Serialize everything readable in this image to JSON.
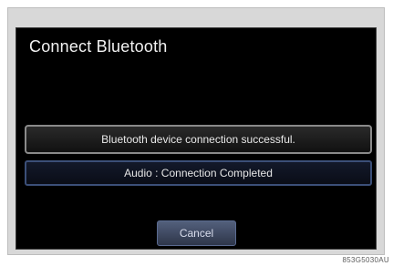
{
  "dialog": {
    "title": "Connect Bluetooth",
    "message": "Bluetooth device connection successful.",
    "status": "Audio : Connection Completed",
    "cancel_label": "Cancel"
  },
  "footer": {
    "code": "853G5030AU"
  },
  "colors": {
    "screen_background": "#000000",
    "message_border": "#8a8a8a",
    "status_border": "#3b4f78",
    "button_fill": "#46526c"
  }
}
